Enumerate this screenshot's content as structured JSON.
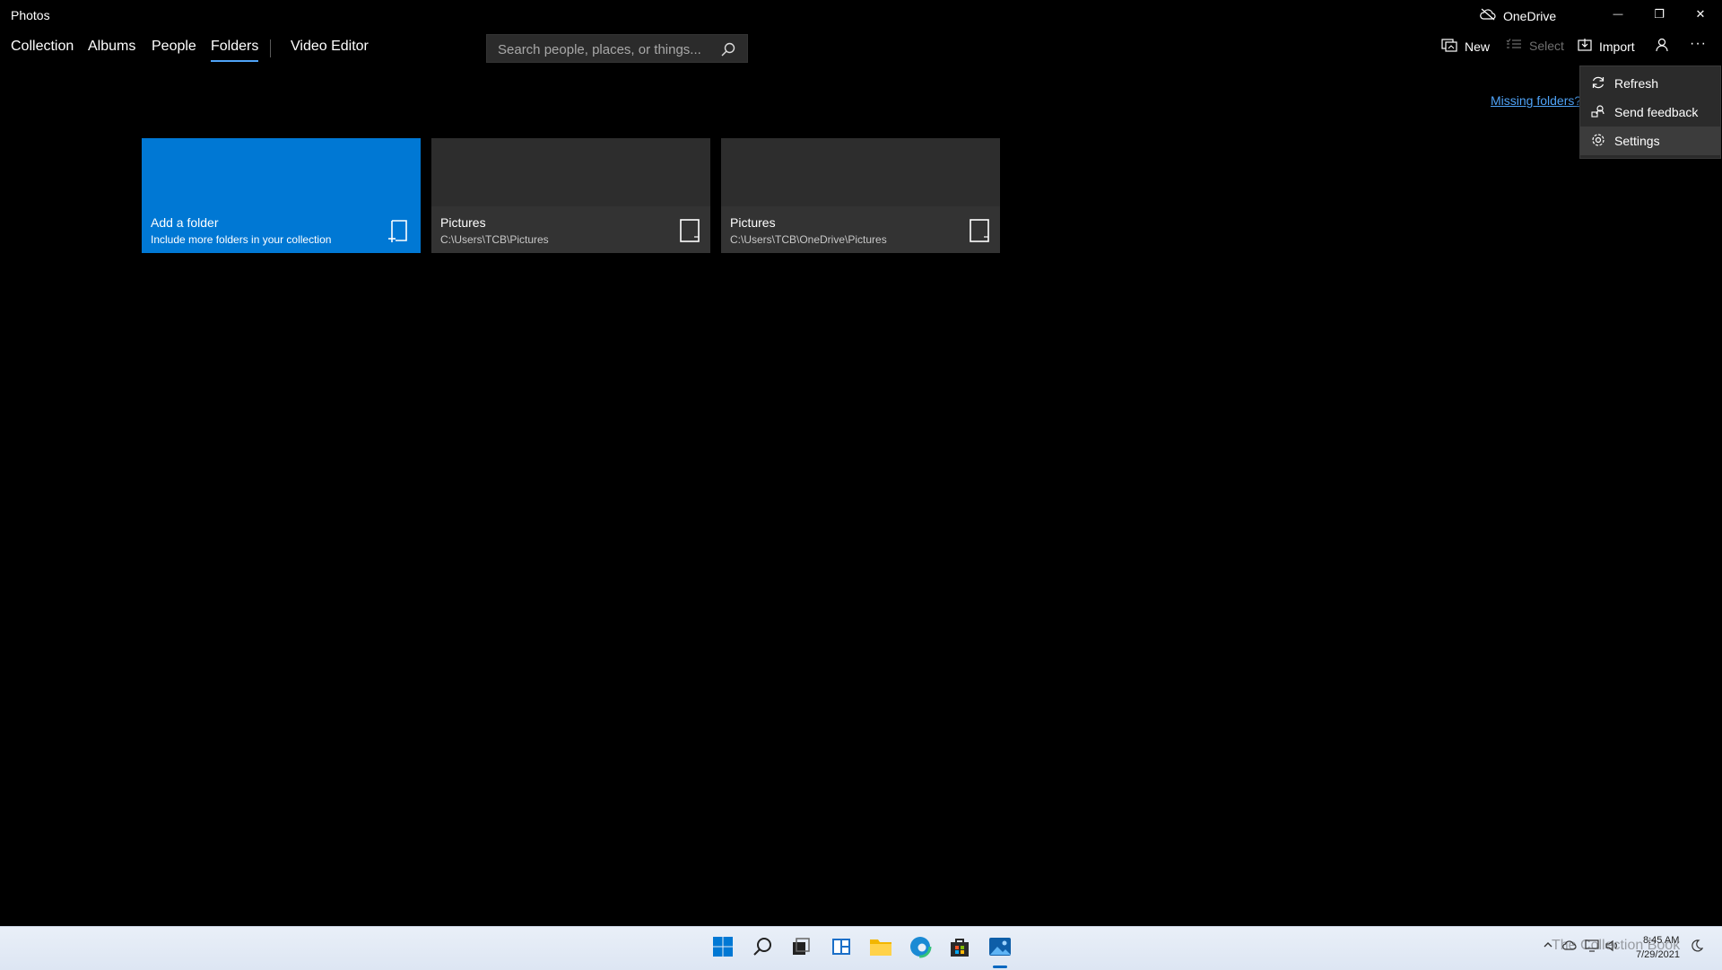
{
  "window": {
    "title": "Photos",
    "onedrive_label": "OneDrive",
    "minimize_glyph": "—",
    "restore_glyph": "❐",
    "close_glyph": "✕"
  },
  "nav": {
    "tabs": [
      {
        "label": "Collection"
      },
      {
        "label": "Albums"
      },
      {
        "label": "People"
      },
      {
        "label": "Folders",
        "active": true
      },
      {
        "label": "Video Editor"
      }
    ]
  },
  "search": {
    "placeholder": "Search people, places, or things..."
  },
  "toolbar": {
    "new_label": "New",
    "select_label": "Select",
    "import_label": "Import",
    "more_glyph": "···"
  },
  "missing_folders_link": "Missing folders?",
  "menu": {
    "items": [
      {
        "label": "Refresh",
        "icon": "refresh-icon"
      },
      {
        "label": "Send feedback",
        "icon": "feedback-icon"
      },
      {
        "label": "Settings",
        "icon": "gear-icon"
      }
    ]
  },
  "tiles": [
    {
      "title": "Add a folder",
      "subtitle": "Include more folders in your collection",
      "icon": "add-folder-icon",
      "color": "#0078d4"
    },
    {
      "title": "Pictures",
      "subtitle": "C:\\Users\\TCB\\Pictures",
      "icon": "folder-tile-icon"
    },
    {
      "title": "Pictures",
      "subtitle": "C:\\Users\\TCB\\OneDrive\\Pictures",
      "icon": "folder-tile-icon"
    }
  ],
  "taskbar": {
    "time": "8:45 AM",
    "date": "7/29/2021",
    "watermark": "The Collection Book"
  },
  "colors": {
    "accent": "#0078d4",
    "link": "#4fa3f7",
    "background": "#000000",
    "menu_bg": "#2b2b2b"
  }
}
